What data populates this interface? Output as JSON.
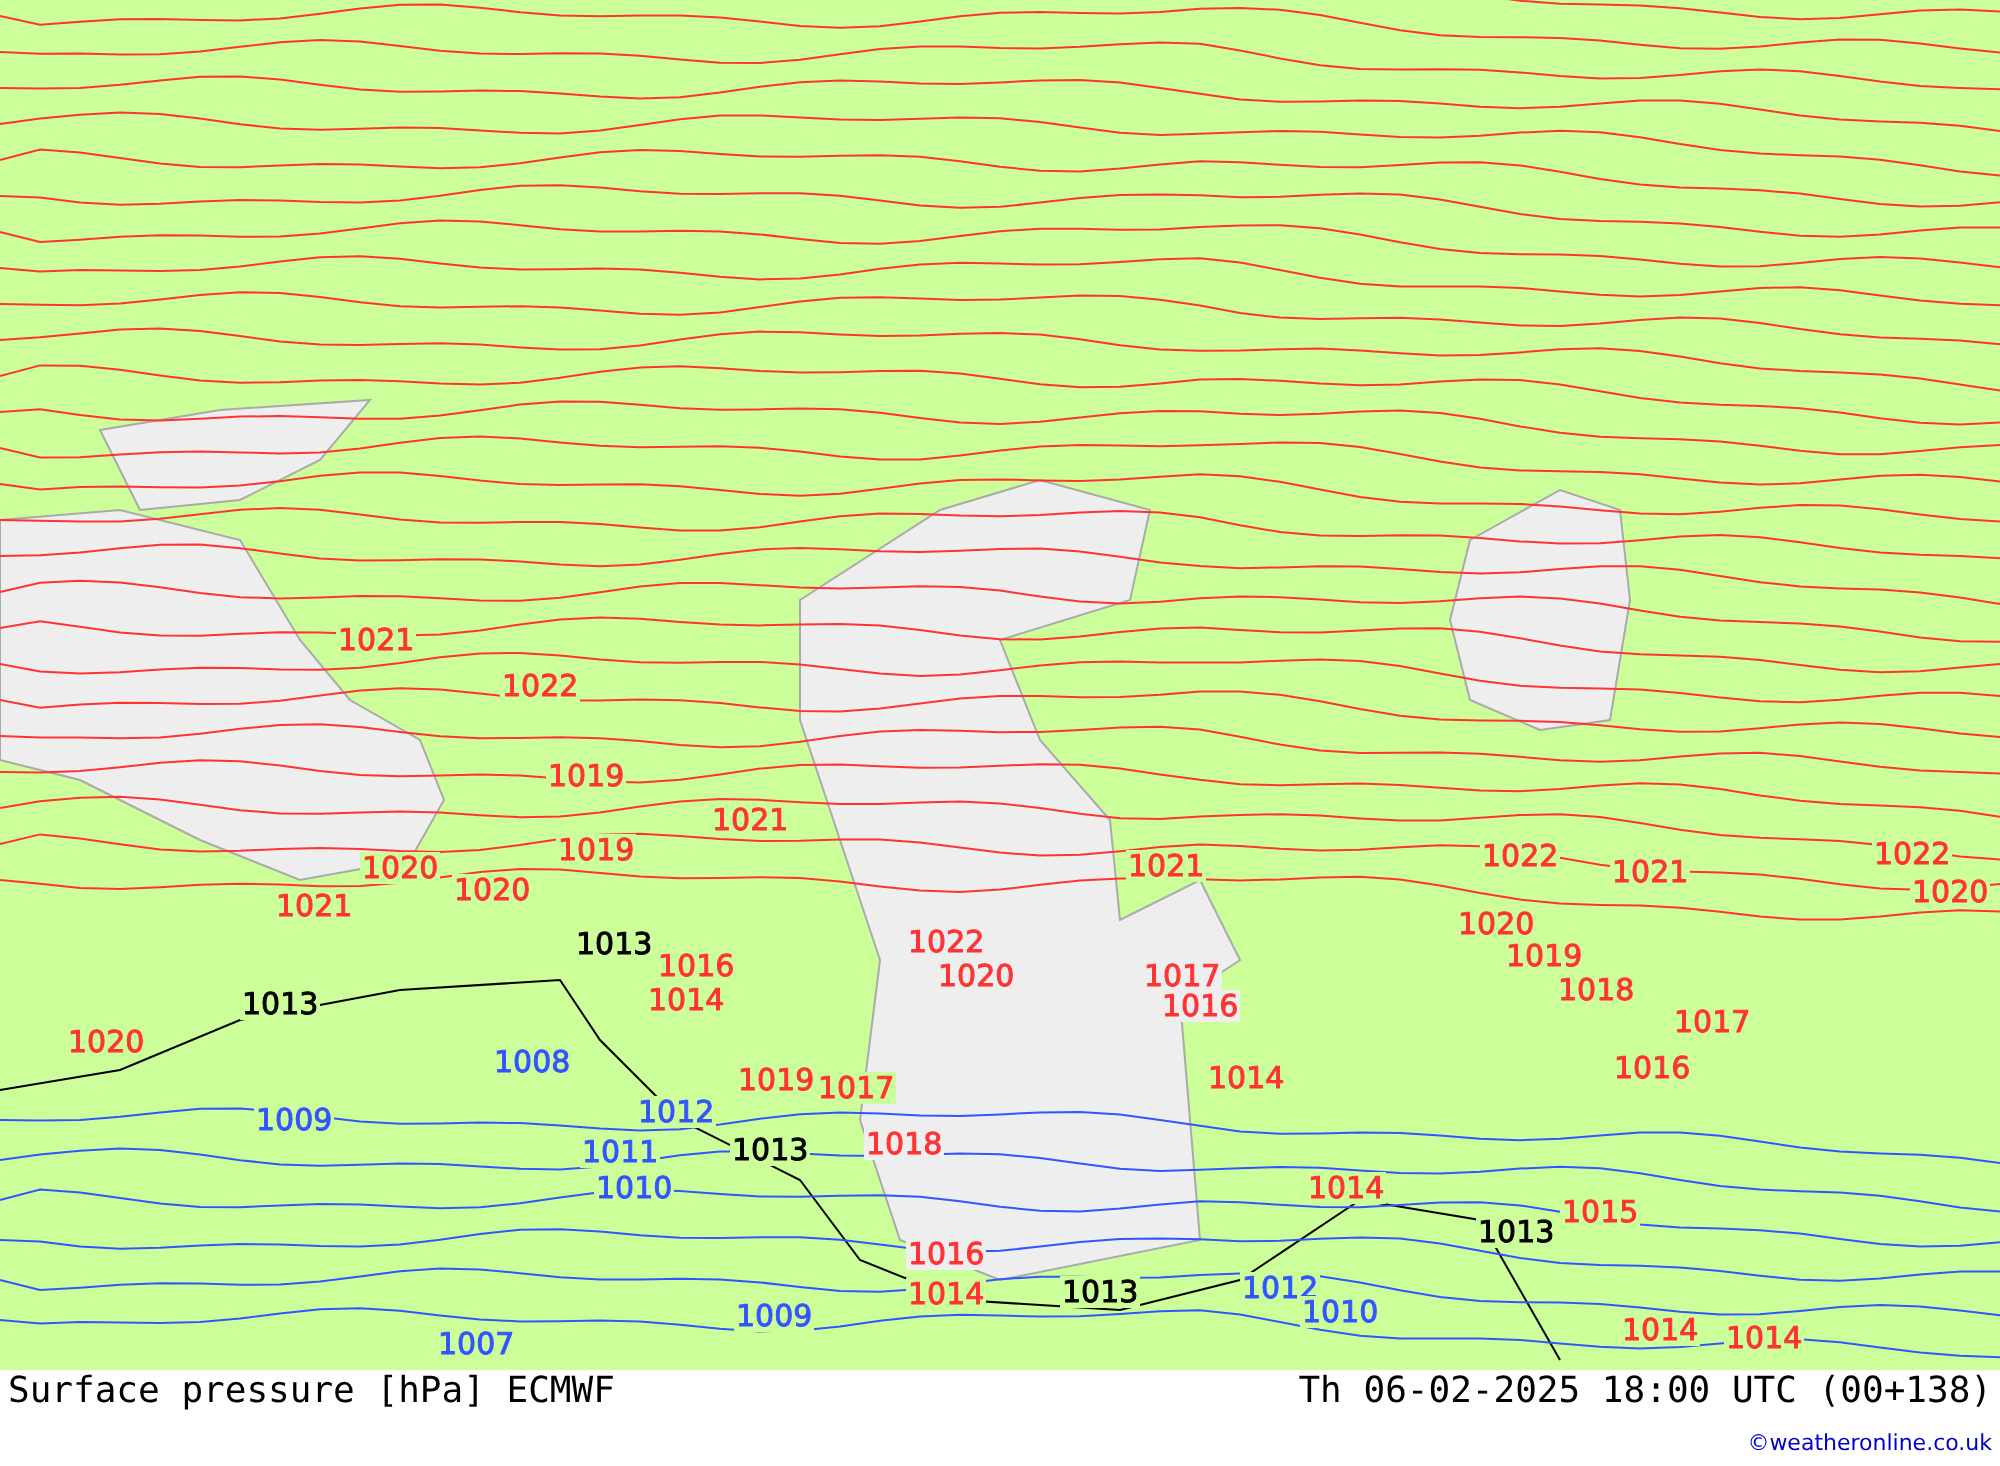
{
  "map": {
    "isobar_labels": [
      {
        "text": "1021",
        "color": "#ff3333"
      },
      {
        "text": "1022",
        "color": "#ff3333"
      },
      {
        "text": "1019",
        "color": "#ff3333"
      },
      {
        "text": "1021",
        "color": "#ff3333"
      },
      {
        "text": "1019",
        "color": "#ff3333"
      },
      {
        "text": "1022",
        "color": "#ff3333"
      },
      {
        "text": "1022",
        "color": "#ff3333"
      },
      {
        "text": "1020",
        "color": "#ff3333"
      },
      {
        "text": "1021",
        "color": "#ff3333"
      },
      {
        "text": "1021",
        "color": "#ff3333"
      },
      {
        "text": "1020",
        "color": "#ff3333"
      },
      {
        "text": "1020",
        "color": "#ff3333"
      },
      {
        "text": "1021",
        "color": "#ff3333"
      },
      {
        "text": "1020",
        "color": "#ff3333"
      },
      {
        "text": "1013",
        "color": "#000000"
      },
      {
        "text": "1022",
        "color": "#ff3333"
      },
      {
        "text": "1019",
        "color": "#ff3333"
      },
      {
        "text": "1016",
        "color": "#ff3333"
      },
      {
        "text": "1020",
        "color": "#ff3333"
      },
      {
        "text": "1017",
        "color": "#ff3333"
      },
      {
        "text": "1018",
        "color": "#ff3333"
      },
      {
        "text": "1013",
        "color": "#000000"
      },
      {
        "text": "1014",
        "color": "#ff3333"
      },
      {
        "text": "1016",
        "color": "#ff3333"
      },
      {
        "text": "1017",
        "color": "#ff3333"
      },
      {
        "text": "1020",
        "color": "#ff3333"
      },
      {
        "text": "1008",
        "color": "#3355ff"
      },
      {
        "text": "1016",
        "color": "#ff3333"
      },
      {
        "text": "1019",
        "color": "#ff3333"
      },
      {
        "text": "1014",
        "color": "#ff3333"
      },
      {
        "text": "1017",
        "color": "#ff3333"
      },
      {
        "text": "1009",
        "color": "#3355ff"
      },
      {
        "text": "1012",
        "color": "#3355ff"
      },
      {
        "text": "1011",
        "color": "#3355ff"
      },
      {
        "text": "1013",
        "color": "#000000"
      },
      {
        "text": "1018",
        "color": "#ff3333"
      },
      {
        "text": "1010",
        "color": "#3355ff"
      },
      {
        "text": "1014",
        "color": "#ff3333"
      },
      {
        "text": "1015",
        "color": "#ff3333"
      },
      {
        "text": "1013",
        "color": "#000000"
      },
      {
        "text": "1016",
        "color": "#ff3333"
      },
      {
        "text": "1014",
        "color": "#ff3333"
      },
      {
        "text": "1013",
        "color": "#000000"
      },
      {
        "text": "1012",
        "color": "#3355ff"
      },
      {
        "text": "1009",
        "color": "#3355ff"
      },
      {
        "text": "1010",
        "color": "#3355ff"
      },
      {
        "text": "1007",
        "color": "#3355ff"
      },
      {
        "text": "1014",
        "color": "#ff3333"
      },
      {
        "text": "1014",
        "color": "#ff3333"
      }
    ]
  },
  "footer": {
    "title": "Surface pressure [hPa] ECMWF",
    "valid_time": "Th 06-02-2025 18:00 UTC (00+138)",
    "credit": "©weatheronline.co.uk"
  }
}
